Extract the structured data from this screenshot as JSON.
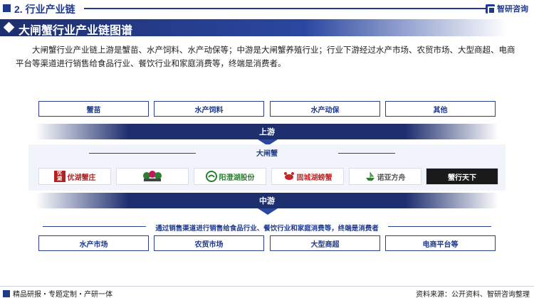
{
  "header": {
    "section_title": "2. 行业产业链",
    "brand": "智研咨询"
  },
  "banner": {
    "title": "大闸蟹行业产业链图谱"
  },
  "intro": "大闸蟹行业产业链上游是蟹苗、水产饲料、水产动保等；中游是大闸蟹养殖行业；行业下游经过水产市场、农贸市场、大型商超、电商平台等渠道进行销售给食品行业、餐饮行业和家庭消费等，终端是消费者。",
  "upstream": {
    "items": [
      "蟹苗",
      "水产饲料",
      "水产动保",
      "其他"
    ],
    "stage_label": "上游"
  },
  "midstream": {
    "title": "大闸蟹",
    "companies": [
      "优湖蟹庄",
      "",
      "阳澄湖股份",
      "固城湖螃蟹",
      "诺亚方舟",
      "蟹行天下"
    ],
    "stage_label": "中游"
  },
  "downstream": {
    "channel_text": "通过销售渠道进行销售给食品行业、餐饮行业和家庭消费等，终端是消费者",
    "items": [
      "水产市场",
      "农贸市场",
      "大型商超",
      "电商平台等"
    ]
  },
  "footer": {
    "left": "精品研报・专题定制・产研一体",
    "right": "资料来源：公开资料、智研咨询整理"
  },
  "colors": {
    "primary": "#1f3a8a",
    "banner": "#1e2f6e",
    "panel": "#f1f5fb"
  }
}
